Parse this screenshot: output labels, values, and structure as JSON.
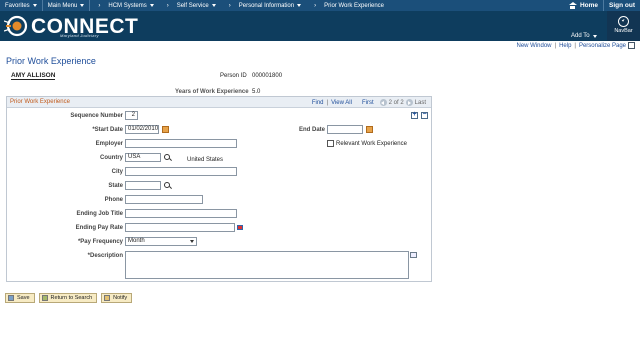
{
  "topnav": {
    "favorites": "Favorites",
    "main_menu": "Main Menu",
    "breadcrumbs": [
      "HCM Systems",
      "Self Service",
      "Personal Information",
      "Prior Work Experience"
    ],
    "home": "Home",
    "sign_out": "Sign out"
  },
  "banner": {
    "logo": "CONNECT",
    "logo_sub": "Maryland Judiciary",
    "add_to": "Add To",
    "navbar": "NavBar"
  },
  "links": {
    "new_window": "New Window",
    "help": "Help",
    "personalize": "Personalize Page"
  },
  "page": {
    "title": "Prior Work Experience",
    "employee_name": "AMY ALLISON",
    "person_id_label": "Person ID",
    "person_id": "000001800",
    "years_label": "Years of Work Experience",
    "years_value": "5.0"
  },
  "grid": {
    "title": "Prior Work Experience",
    "find": "Find",
    "view_all": "View All",
    "first": "First",
    "position": "2 of 2",
    "last": "Last"
  },
  "form": {
    "sequence_label": "Sequence Number",
    "sequence_value": "2",
    "start_date_label": "*Start Date",
    "start_date_value": "01/02/2010",
    "end_date_label": "End Date",
    "end_date_value": "",
    "relevant_label": "Relevant Work Experience",
    "employer_label": "Employer",
    "country_label": "Country",
    "country_value": "USA",
    "country_desc": "United States",
    "city_label": "City",
    "state_label": "State",
    "phone_label": "Phone",
    "job_title_label": "Ending Job Title",
    "pay_rate_label": "Ending Pay Rate",
    "pay_freq_label": "*Pay Frequency",
    "pay_freq_value": "Month",
    "description_label": "*Description"
  },
  "buttons": {
    "save": "Save",
    "return": "Return to Search",
    "notify": "Notify"
  }
}
